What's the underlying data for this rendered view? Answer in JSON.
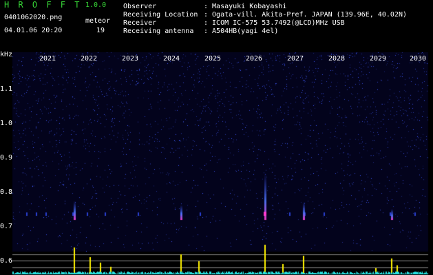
{
  "header": {
    "app_title": "H R O F F T",
    "app_version": "1.0.0",
    "filename": "0401062020.png",
    "timestamp": "04.01.06 20:20",
    "meteor_label": "meteor",
    "meteor_count": "19"
  },
  "info": [
    {
      "key": "Observer",
      "value": ": Masayuki Kobayashi"
    },
    {
      "key": "Receiving Location",
      "value": ": Ogata-vill. Akita-Pref. JAPAN (139.96E, 40.02N)"
    },
    {
      "key": "Receiver",
      "value": ": ICOM IC-575 53.7492(@LCD)MHz USB"
    },
    {
      "key": "Receiving antenna",
      "value": ": A504HB(yagi 4el)"
    }
  ],
  "axis": {
    "unit": "kHz",
    "y_ticks": [
      "1.1",
      "1.0",
      "0.9",
      "0.8",
      "0.7",
      "0.6"
    ],
    "x_ticks": [
      "2021",
      "2022",
      "2023",
      "2024",
      "2025",
      "2026",
      "2027",
      "2028",
      "2029",
      "2030"
    ]
  },
  "colors": {
    "title": "#37d637",
    "spectrum_bg": "#03031c",
    "noise": "#2a3fd0",
    "event": "#ff3ad0",
    "echo_bar": "#fff200",
    "baseline": "#27e3e3",
    "grid_line": "#888888"
  }
}
